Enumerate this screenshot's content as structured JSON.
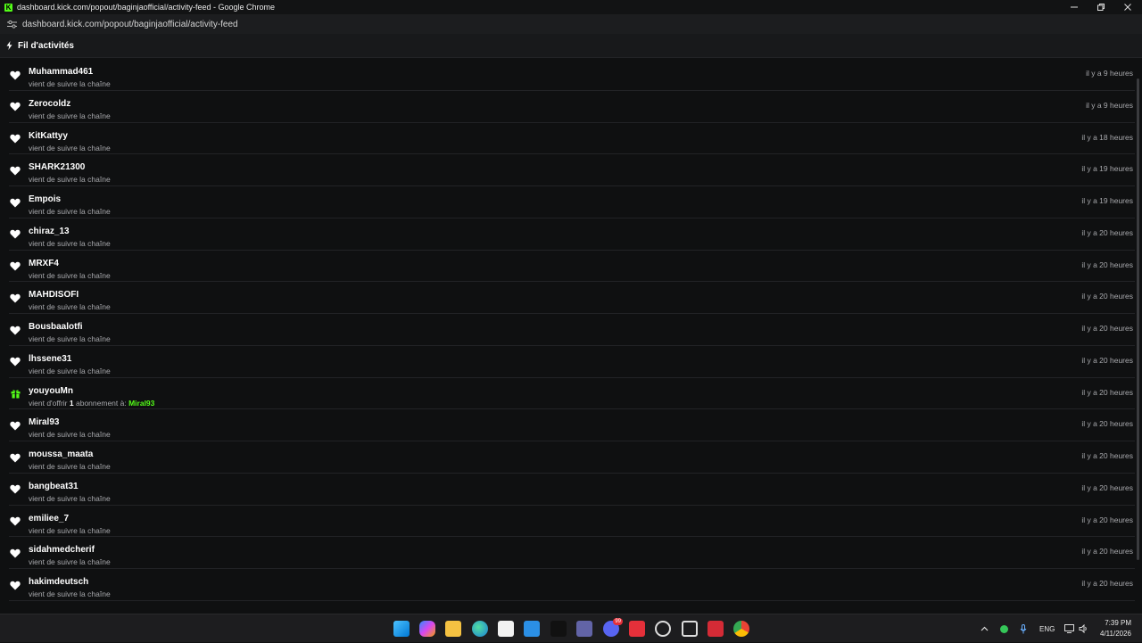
{
  "window": {
    "title": "dashboard.kick.com/popout/baginjaofficial/activity-feed - Google Chrome",
    "url": "dashboard.kick.com/popout/baginjaofficial/activity-feed",
    "favicon_letter": "K"
  },
  "header": {
    "title": "Fil d'activités",
    "icon": "bolt-icon"
  },
  "colors": {
    "accent": "#53fc18",
    "background": "#0f1011",
    "muted_text": "#a8a9ad"
  },
  "feed": [
    {
      "user": "Muhammad461",
      "type": "follow",
      "action": "vient de suivre la chaîne",
      "time": "il y a 9 heures"
    },
    {
      "user": "Zerocoldz",
      "type": "follow",
      "action": "vient de suivre la chaîne",
      "time": "il y a 9 heures"
    },
    {
      "user": "KitKattyy",
      "type": "follow",
      "action": "vient de suivre la chaîne",
      "time": "il y a 18 heures"
    },
    {
      "user": "SHARK21300",
      "type": "follow",
      "action": "vient de suivre la chaîne",
      "time": "il y a 19 heures"
    },
    {
      "user": "Empois",
      "type": "follow",
      "action": "vient de suivre la chaîne",
      "time": "il y a 19 heures"
    },
    {
      "user": "chiraz_13",
      "type": "follow",
      "action": "vient de suivre la chaîne",
      "time": "il y a 20 heures"
    },
    {
      "user": "MRXF4",
      "type": "follow",
      "action": "vient de suivre la chaîne",
      "time": "il y a 20 heures"
    },
    {
      "user": "MAHDISOFI",
      "type": "follow",
      "action": "vient de suivre la chaîne",
      "time": "il y a 20 heures"
    },
    {
      "user": "Bousbaalotfi",
      "type": "follow",
      "action": "vient de suivre la chaîne",
      "time": "il y a 20 heures"
    },
    {
      "user": "lhssene31",
      "type": "follow",
      "action": "vient de suivre la chaîne",
      "time": "il y a 20 heures"
    },
    {
      "user": "youyouMn",
      "type": "gift",
      "action": "vient d'offrir",
      "gift_count": "1",
      "gift_text": "abonnement à:",
      "gift_recipient": "Miral93",
      "time": "il y a 20 heures"
    },
    {
      "user": "Miral93",
      "type": "follow",
      "action": "vient de suivre la chaîne",
      "time": "il y a 20 heures"
    },
    {
      "user": "moussa_maata",
      "type": "follow",
      "action": "vient de suivre la chaîne",
      "time": "il y a 20 heures"
    },
    {
      "user": "bangbeat31",
      "type": "follow",
      "action": "vient de suivre la chaîne",
      "time": "il y a 20 heures"
    },
    {
      "user": "emiliee_7",
      "type": "follow",
      "action": "vient de suivre la chaîne",
      "time": "il y a 20 heures"
    },
    {
      "user": "sidahmedcherif",
      "type": "follow",
      "action": "vient de suivre la chaîne",
      "time": "il y a 20 heures"
    },
    {
      "user": "hakimdeutsch",
      "type": "follow",
      "action": "vient de suivre la chaîne",
      "time": "il y a 20 heures"
    }
  ],
  "taskbar": {
    "apps": [
      "windows-start-icon",
      "copilot-icon",
      "file-explorer-icon",
      "edge-icon",
      "store-icon",
      "mail-icon",
      "tiktok-icon",
      "teams-icon",
      "discord-icon",
      "app-red-icon",
      "chatgpt-icon",
      "app-box-icon",
      "app-red2-icon",
      "chrome-icon"
    ],
    "discord_badge": "99",
    "language": "ENG",
    "time": "7:39 PM",
    "date": "4/11/2026"
  }
}
